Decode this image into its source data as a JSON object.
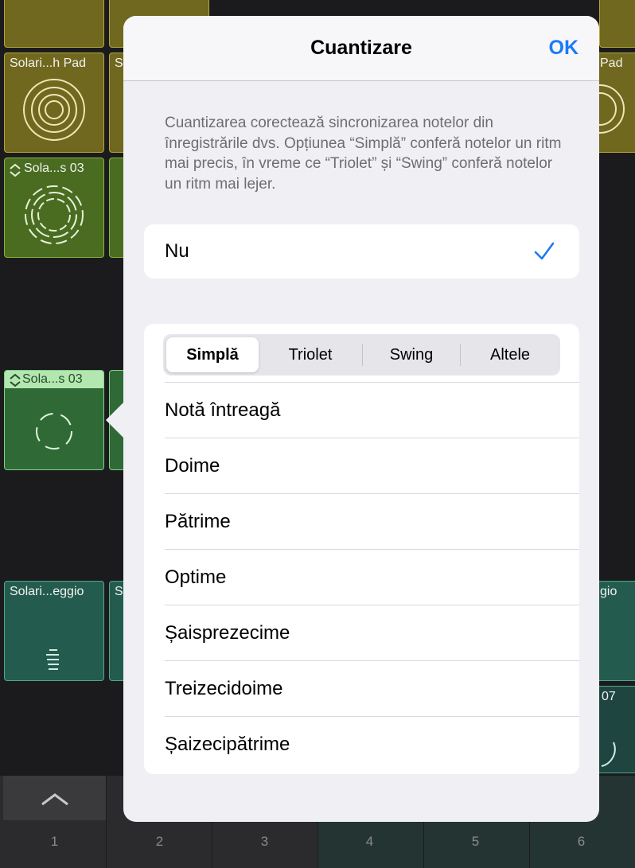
{
  "background": {
    "cells": [
      {
        "label": "Solari...h Pad",
        "style": "yellow"
      },
      {
        "label": "S",
        "style": "yellow"
      },
      {
        "label": "Pad",
        "style": "yellow"
      },
      {
        "label": "Sola...s 03",
        "style": "olive"
      },
      {
        "label": "Sola...s 03",
        "style": "green"
      },
      {
        "label": "Solari...eggio",
        "style": "teal"
      },
      {
        "label": "S",
        "style": "teal"
      },
      {
        "label": "gio",
        "style": "teal"
      },
      {
        "label": "07",
        "style": "teal"
      }
    ],
    "columns": [
      "1",
      "2",
      "3",
      "4",
      "5",
      "6"
    ],
    "chevron_icon": "chevron-up-icon"
  },
  "popover": {
    "title": "Cuantizare",
    "ok_label": "OK",
    "description": "Cuantizarea corectează sincronizarea notelor din înregistrările dvs. Opțiunea “Simplă” conferă notelor un ritm mai precis, în vreme ce “Triolet” și “Swing” conferă notelor un ritm mai lejer.",
    "none_option": {
      "label": "Nu",
      "selected": true,
      "icon": "checkmark-icon"
    },
    "segments": [
      {
        "label": "Simplă",
        "selected": true
      },
      {
        "label": "Triolet",
        "selected": false
      },
      {
        "label": "Swing",
        "selected": false
      },
      {
        "label": "Altele",
        "selected": false
      }
    ],
    "options": [
      "Notă întreagă",
      "Doime",
      "Pătrime",
      "Optime",
      "Șaisprezecime",
      "Treizecidoime",
      "Șaizecipătrime"
    ]
  },
  "colors": {
    "accent": "#1a7bf6",
    "sheet": "#efeff4"
  }
}
